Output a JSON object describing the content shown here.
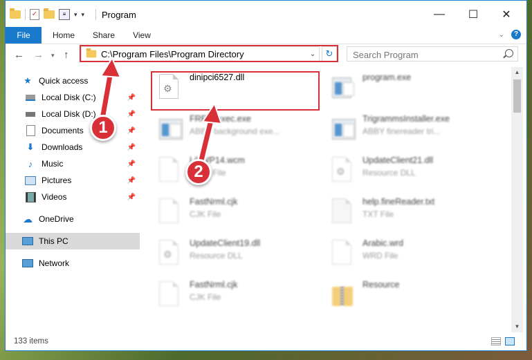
{
  "window": {
    "title": "Program"
  },
  "title_buttons": {
    "minimize": "—",
    "maximize": "☐",
    "close": "✕"
  },
  "ribbon": {
    "tabs": [
      {
        "label": "File"
      },
      {
        "label": "Home"
      },
      {
        "label": "Share"
      },
      {
        "label": "View"
      }
    ]
  },
  "address": {
    "path": "C:\\Program Files\\Program Directory"
  },
  "search": {
    "placeholder": "Search Program"
  },
  "sidebar": {
    "items": [
      {
        "label": "Quick access",
        "icon": "star-icon"
      },
      {
        "label": "Local Disk (C:)",
        "icon": "drive-icon"
      },
      {
        "label": "Local Disk (D:)",
        "icon": "drive-icon"
      },
      {
        "label": "Documents",
        "icon": "documents-icon"
      },
      {
        "label": "Downloads",
        "icon": "download-icon"
      },
      {
        "label": "Music",
        "icon": "music-icon"
      },
      {
        "label": "Pictures",
        "icon": "pictures-icon"
      },
      {
        "label": "Videos",
        "icon": "videos-icon"
      },
      {
        "label": "OneDrive",
        "icon": "cloud-icon"
      },
      {
        "label": "This PC",
        "icon": "computer-icon"
      },
      {
        "label": "Network",
        "icon": "network-icon"
      }
    ]
  },
  "files": [
    {
      "name": "dinipci6527.dll",
      "type": ""
    },
    {
      "name": "program.exe",
      "type": ""
    },
    {
      "name": "FREngexec.exe",
      "type": "ABBY background exe..."
    },
    {
      "name": "TrigrammsInstaller.exe",
      "type": "ABBY finereader tri..."
    },
    {
      "name": "LibWP14.wcm",
      "type": "WCM File"
    },
    {
      "name": "UpdateClient21.dll",
      "type": "Resource DLL"
    },
    {
      "name": "FastNrml.cjk",
      "type": "CJK File"
    },
    {
      "name": "help.fineReader.txt",
      "type": "TXT File"
    },
    {
      "name": "UpdateClient19.dll",
      "type": "Resource DLL"
    },
    {
      "name": "Arabic.wrd",
      "type": "WRD File"
    },
    {
      "name": "FastNrml.cjk",
      "type": "CJK File"
    },
    {
      "name": "Resource",
      "type": ""
    }
  ],
  "status": {
    "item_count": "133 items"
  },
  "callouts": {
    "step1": "1",
    "step2": "2"
  },
  "colors": {
    "accent": "#1979ca",
    "highlight": "#d93038"
  }
}
